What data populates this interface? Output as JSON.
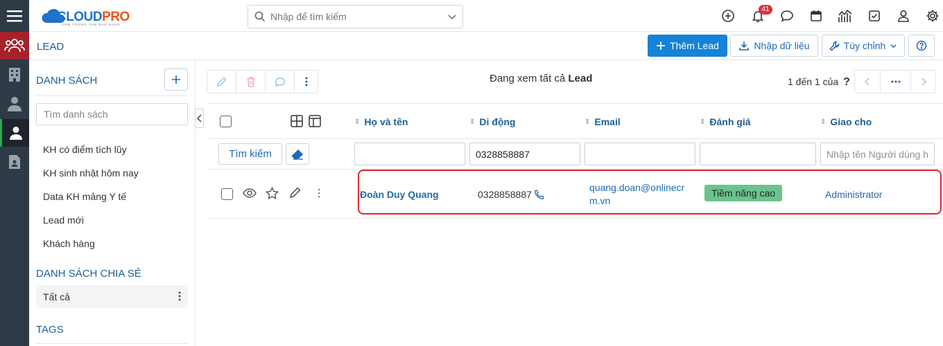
{
  "topbar": {
    "logo": {
      "brand_left": "CLOUD",
      "brand_right": "PRO",
      "tagline": "CRM TRONG TAM BAN HANG"
    },
    "search": {
      "placeholder": "Nhập để tìm kiếm"
    },
    "notifications_count": "41",
    "icons": [
      "plus-circle-icon",
      "bell-icon",
      "chat-icon",
      "calendar-icon",
      "chart-icon",
      "checkbox-icon",
      "user-icon",
      "gear-icon"
    ]
  },
  "header": {
    "module_title": "LEAD",
    "add_lead_label": "Thêm Lead",
    "import_label": "Nhập dữ liệu",
    "customize_label": "Tùy chỉnh"
  },
  "sidebar": {
    "list_heading": "DANH SÁCH",
    "search_placeholder": "Tìm danh sách",
    "lists": [
      "KH có điểm tích lũy",
      "KH sinh nhật hôm nay",
      "Data KH mảng Y tế",
      "Lead mới",
      "Khách hàng"
    ],
    "shared_heading": "DANH SÁCH CHIA SẺ",
    "shared_items": [
      "Tất cả"
    ],
    "tags_heading": "TAGS"
  },
  "main": {
    "viewing_prefix": "Đang xem tất cả",
    "viewing_module": "Lead",
    "paging_text": "1 đến 1 của",
    "paging_unknown": "?",
    "columns": [
      "Họ và tên",
      "Di động",
      "Email",
      "Đánh giá",
      "Giao cho"
    ],
    "filter": {
      "search_label": "Tìm kiếm",
      "values": [
        "",
        "0328858887",
        "",
        "",
        ""
      ],
      "assignee_placeholder": "Nhập tên Người dùng hoặc Nhóm"
    },
    "rows": [
      {
        "name": "Đoàn Duy Quang",
        "mobile": "0328858887",
        "email_line1": "quang.doan@onlinecr",
        "email_line2": "m.vn",
        "rating": "Tiềm năng cao",
        "assignee": "Administrator"
      }
    ]
  },
  "colors": {
    "primary": "#1583d8",
    "rail": "#2f3a47",
    "rail_active": "#a5222a",
    "rating_tag": "#6cc28e",
    "highlight": "#e0242e"
  }
}
